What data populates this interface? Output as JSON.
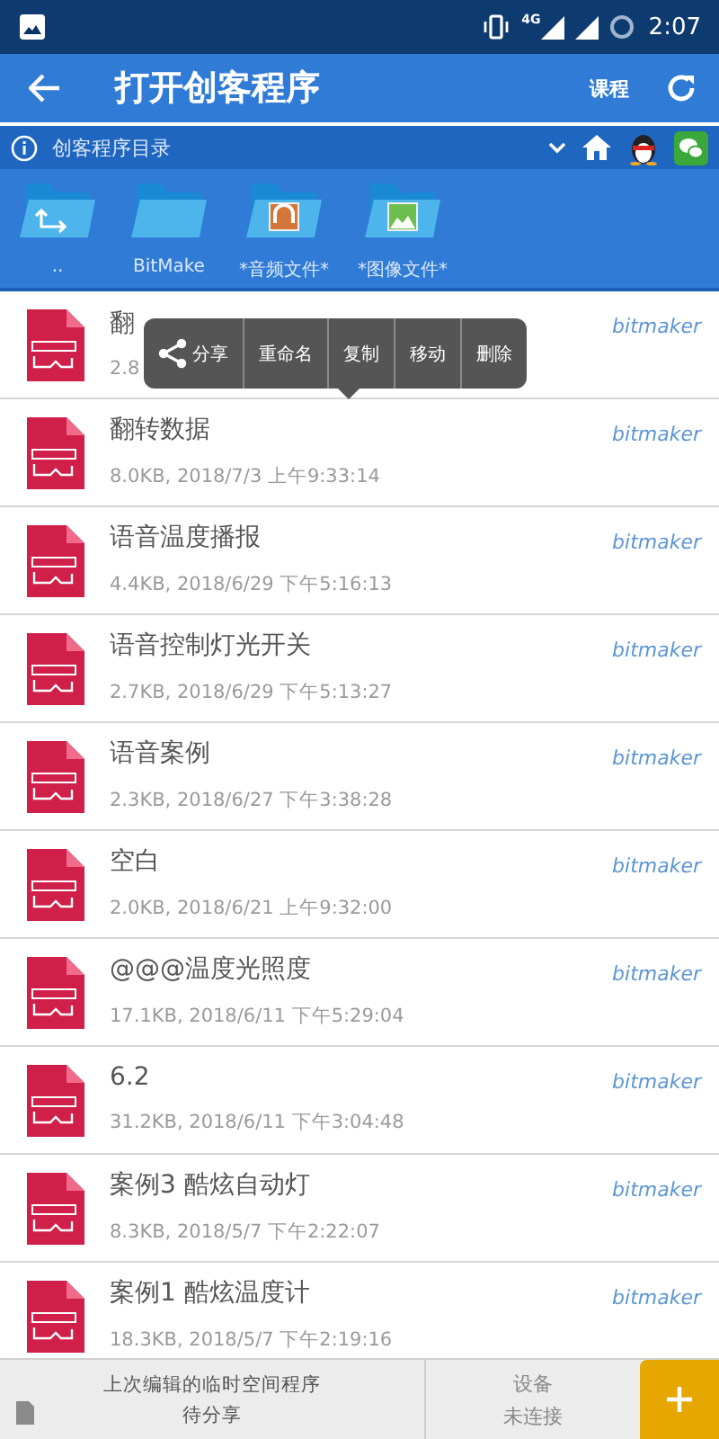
{
  "status_bar": {
    "network": "4G",
    "time": "2:07"
  },
  "app_bar": {
    "title": "打开创客程序",
    "action": "课程"
  },
  "path_bar": {
    "label": "创客程序目录"
  },
  "folders": [
    {
      "label": "..",
      "kind": "up"
    },
    {
      "label": "BitMake",
      "kind": "plain"
    },
    {
      "label": "*音频文件*",
      "kind": "audio"
    },
    {
      "label": "*图像文件*",
      "kind": "image"
    }
  ],
  "files": [
    {
      "name": "翻",
      "meta": "2.8",
      "author": "bitmaker"
    },
    {
      "name": "翻转数据",
      "meta": "8.0KB, 2018/7/3 上午9:33:14",
      "author": "bitmaker"
    },
    {
      "name": "语音温度播报",
      "meta": "4.4KB, 2018/6/29 下午5:16:13",
      "author": "bitmaker"
    },
    {
      "name": "语音控制灯光开关",
      "meta": "2.7KB, 2018/6/29 下午5:13:27",
      "author": "bitmaker"
    },
    {
      "name": "语音案例",
      "meta": "2.3KB, 2018/6/27 下午3:38:28",
      "author": "bitmaker"
    },
    {
      "name": "空白",
      "meta": "2.0KB, 2018/6/21 上午9:32:00",
      "author": "bitmaker"
    },
    {
      "name": "@@@温度光照度",
      "meta": "17.1KB, 2018/6/11 下午5:29:04",
      "author": "bitmaker"
    },
    {
      "name": "6.2",
      "meta": "31.2KB, 2018/6/11 下午3:04:48",
      "author": "bitmaker"
    },
    {
      "name": "案例3 酷炫自动灯",
      "meta": "8.3KB, 2018/5/7 下午2:22:07",
      "author": "bitmaker"
    },
    {
      "name": "案例1 酷炫温度计",
      "meta": "18.3KB, 2018/5/7 下午2:19:16",
      "author": "bitmaker"
    }
  ],
  "context_menu": [
    {
      "label": "分享",
      "kind": "share"
    },
    {
      "label": "重命名",
      "kind": "plain"
    },
    {
      "label": "复制",
      "kind": "plain"
    },
    {
      "label": "移动",
      "kind": "plain"
    },
    {
      "label": "删除",
      "kind": "plain"
    }
  ],
  "bottom_bar": {
    "recent_title": "上次编辑的临时空间程序",
    "recent_status": "待分享",
    "device_title": "设备",
    "device_status": "未连接"
  }
}
